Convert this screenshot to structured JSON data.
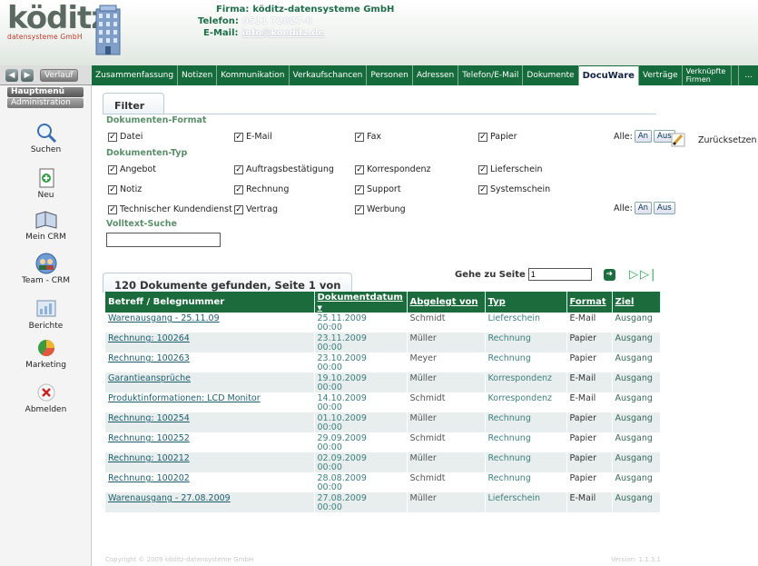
{
  "header": {
    "logo_text": "köditz",
    "logo_sub": "datensysteme GmbH",
    "firma_label": "Firma:",
    "firma": "köditz-datensysteme GmbH",
    "telefon_label": "Telefon:",
    "telefon": "0511 72827-0",
    "email_label": "E-Mail:",
    "email": "info@koeditz.de"
  },
  "nav": {
    "back_icon": "arrow-left-icon",
    "forward_icon": "arrow-right-icon",
    "verlauf": "Verlauf",
    "tabs": [
      {
        "label": "Zusammenfassung"
      },
      {
        "label": "Notizen"
      },
      {
        "label": "Kommunikation"
      },
      {
        "label": "Verkaufschancen"
      },
      {
        "label": "Personen"
      },
      {
        "label": "Adressen"
      },
      {
        "label": "Telefon/E-Mail"
      },
      {
        "label": "Dokumente"
      },
      {
        "label": "DocuWare"
      },
      {
        "label": "Verträge"
      },
      {
        "label": "Verknüpfte Firmen"
      },
      {
        "label": "..."
      }
    ]
  },
  "sidebar": {
    "hauptmenu": "Hauptmenü",
    "administration": "Administration",
    "items": [
      {
        "label": "Suchen",
        "icon": "magnifier-icon"
      },
      {
        "label": "Neu",
        "icon": "new-document-icon"
      },
      {
        "label": "Mein CRM",
        "icon": "crm-icon"
      },
      {
        "label": "Team - CRM",
        "icon": "team-icon"
      },
      {
        "label": "Berichte",
        "icon": "report-icon"
      },
      {
        "label": "Marketing",
        "icon": "pie-chart-icon"
      },
      {
        "label": "Abmelden",
        "icon": "logout-icon"
      }
    ]
  },
  "filter": {
    "title": "Filter",
    "format_title": "Dokumenten-Format",
    "formats": [
      "Datei",
      "E-Mail",
      "Fax",
      "Papier"
    ],
    "typ_title": "Dokumenten-Typ",
    "types": [
      "Angebot",
      "Auftragsbestätigung",
      "Korrespondenz",
      "Lieferschein",
      "Notiz",
      "Rechnung",
      "Support",
      "Systemschein",
      "Technischer Kundendienst",
      "Vertrag",
      "Werbung"
    ],
    "alle": "Alle:",
    "an": "An",
    "aus": "Aus",
    "reset": "Zurücksetzen",
    "fulltext_title": "Volltext-Suche",
    "fulltext_value": ""
  },
  "results": {
    "summary": "120 Dokumente gefunden, Seite 1 von 12",
    "goto_label": "Gehe zu Seite",
    "goto_value": "1",
    "columns": [
      "Betreff / Belegnummer",
      "Dokumentdatum",
      "Abgelegt von",
      "Typ",
      "Format",
      "Ziel"
    ],
    "rows": [
      {
        "subject": "Warenausgang - 25.11.09",
        "date": "25.11.2009",
        "time": "00:00",
        "by": "Schmidt",
        "typ": "Lieferschein",
        "format": "E-Mail",
        "ziel": "Ausgang"
      },
      {
        "subject": "Rechnung: 100264",
        "date": "23.11.2009",
        "time": "00:00",
        "by": "Müller",
        "typ": "Rechnung",
        "format": "Papier",
        "ziel": "Ausgang"
      },
      {
        "subject": "Rechnung: 100263",
        "date": "23.10.2009",
        "time": "00:00",
        "by": "Meyer",
        "typ": "Rechnung",
        "format": "Papier",
        "ziel": "Ausgang"
      },
      {
        "subject": "Garantieansprüche",
        "date": "19.10.2009",
        "time": "00:00",
        "by": "Müller",
        "typ": "Korrespondenz",
        "format": "E-Mail",
        "ziel": "Ausgang"
      },
      {
        "subject": "Produktinformationen: LCD Monitor",
        "date": "14.10.2009",
        "time": "00:00",
        "by": "Schmidt",
        "typ": "Korrespondenz",
        "format": "E-Mail",
        "ziel": "Ausgang"
      },
      {
        "subject": "Rechnung: 100254",
        "date": "01.10.2009",
        "time": "00:00",
        "by": "Müller",
        "typ": "Rechnung",
        "format": "Papier",
        "ziel": "Ausgang"
      },
      {
        "subject": "Rechnung: 100252",
        "date": "29.09.2009",
        "time": "00:00",
        "by": "Schmidt",
        "typ": "Rechnung",
        "format": "Papier",
        "ziel": "Ausgang"
      },
      {
        "subject": "Rechnung: 100212",
        "date": "02.09.2009",
        "time": "00:00",
        "by": "Müller",
        "typ": "Rechnung",
        "format": "Papier",
        "ziel": "Ausgang"
      },
      {
        "subject": "Rechnung: 100202",
        "date": "28.08.2009",
        "time": "00:00",
        "by": "Schmidt",
        "typ": "Rechnung",
        "format": "Papier",
        "ziel": "Ausgang"
      },
      {
        "subject": "Warenausgang - 27.08.2009",
        "date": "27.08.2009",
        "time": "00:00",
        "by": "Müller",
        "typ": "Lieferschein",
        "format": "E-Mail",
        "ziel": "Ausgang"
      }
    ]
  },
  "footer": {
    "copyright": "Copyright © 2009 köditz-datensysteme GmbH",
    "version": "Version: 1.1.3.1"
  },
  "colors": {
    "accent": "#1c6b3c",
    "brand_red": "#c0392b"
  }
}
